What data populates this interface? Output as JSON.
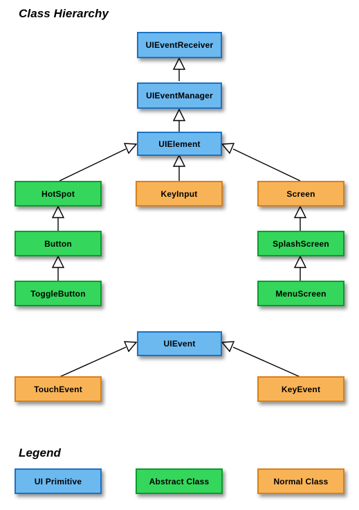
{
  "diagram": {
    "title": "Class Hierarchy",
    "legend_title": "Legend",
    "type": "uml-class-hierarchy",
    "relationship": "generalization (inheritance)",
    "colors": {
      "primitive_fill": "#6cb9f0",
      "primitive_border": "#1a72c4",
      "abstract_fill": "#35d65c",
      "abstract_border": "#0a9c2c",
      "normal_fill": "#f9b357",
      "normal_border": "#d9801a",
      "edge": "#000000",
      "background": "#ffffff"
    }
  },
  "nodes": {
    "ui_event_receiver": "UIEventReceiver",
    "ui_event_manager": "UIEventManager",
    "ui_element": "UIElement",
    "hotspot": "HotSpot",
    "key_input": "KeyInput",
    "screen": "Screen",
    "button": "Button",
    "splash_screen": "SplashScreen",
    "toggle_button": "ToggleButton",
    "menu_screen": "MenuScreen",
    "ui_event": "UIEvent",
    "touch_event": "TouchEvent",
    "key_event": "KeyEvent"
  },
  "legend": {
    "items": [
      {
        "label": "UI Primitive",
        "kind": "primitive"
      },
      {
        "label": "Abstract Class",
        "kind": "abstract"
      },
      {
        "label": "Normal Class",
        "kind": "normal"
      }
    ]
  },
  "edges": [
    {
      "from": "UIEventManager",
      "to": "UIEventReceiver"
    },
    {
      "from": "UIElement",
      "to": "UIEventManager"
    },
    {
      "from": "HotSpot",
      "to": "UIElement"
    },
    {
      "from": "KeyInput",
      "to": "UIElement"
    },
    {
      "from": "Screen",
      "to": "UIElement"
    },
    {
      "from": "Button",
      "to": "HotSpot"
    },
    {
      "from": "ToggleButton",
      "to": "Button"
    },
    {
      "from": "SplashScreen",
      "to": "Screen"
    },
    {
      "from": "MenuScreen",
      "to": "SplashScreen"
    },
    {
      "from": "TouchEvent",
      "to": "UIEvent"
    },
    {
      "from": "KeyEvent",
      "to": "UIEvent"
    }
  ]
}
